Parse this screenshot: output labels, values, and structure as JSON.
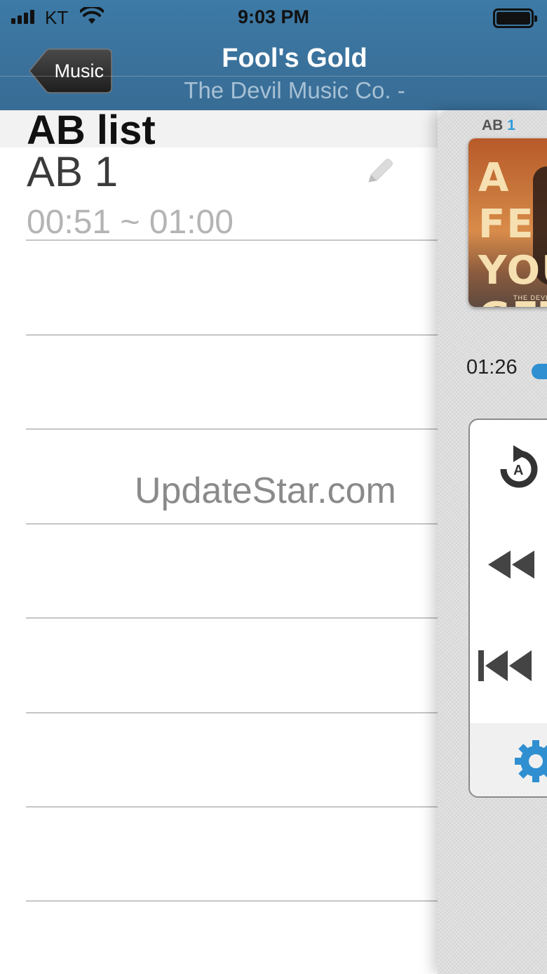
{
  "status_bar": {
    "carrier": "KT",
    "time": "9:03 PM"
  },
  "nav": {
    "back_label": "Music",
    "title": "Fool's Gold",
    "subtitle": "The Devil Music Co. -"
  },
  "ab_list": {
    "title": "AB list",
    "items": [
      {
        "name": "AB 1",
        "range": "00:51 ~ 01:00"
      }
    ]
  },
  "watermark": "UpdateStar.com",
  "player": {
    "ab_prefix": "AB",
    "ab_number": "1",
    "album_art_text": "A FE YOU GET",
    "album_art_caption": "THE DEVI",
    "current_time": "01:26",
    "accent_color": "#2f8fd0"
  }
}
